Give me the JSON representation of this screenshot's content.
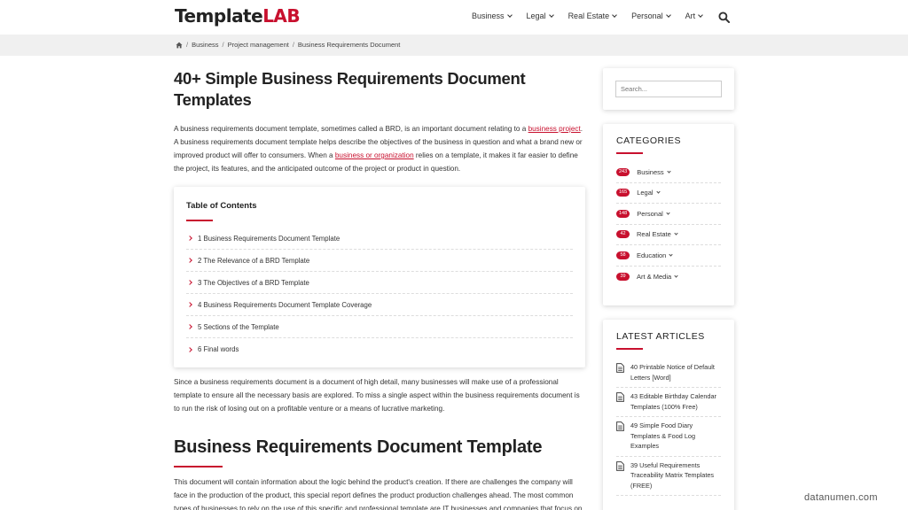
{
  "header": {
    "logo_main": "Template",
    "logo_accent": "LAB",
    "nav": [
      {
        "label": "Business"
      },
      {
        "label": "Legal"
      },
      {
        "label": "Real Estate"
      },
      {
        "label": "Personal"
      },
      {
        "label": "Art"
      }
    ]
  },
  "breadcrumb": [
    "Business",
    "Project management",
    "Business Requirements Document"
  ],
  "main": {
    "title": "40+ Simple Business Requirements Document Templates",
    "intro": {
      "t1": "A business requirements document template, sometimes called a BRD, is an important document relating to a ",
      "link1": "business project",
      "t2": ". A business requirements document template helps describe the objectives of the business in question and what a brand new or improved product will offer to consumers.  When a ",
      "link2": "business or organization",
      "t3": " relies on a template, it makes it far easier to define the project, its features, and the anticipated outcome of the project or product in question."
    },
    "toc": {
      "title": "Table of Contents",
      "items": [
        "1 Business Requirements Document Template",
        "2 The Relevance of a BRD Template",
        "3 The Objectives of a BRD Template",
        "4 Business Requirements Document Template Coverage",
        "5 Sections of the Template",
        "6 Final words"
      ]
    },
    "para2": "Since a business requirements document is a document of high detail, many businesses will make use of a professional template to ensure all the necessary basis are explored. To miss a single aspect within the business requirements document is to run the risk of losing out on a profitable venture or a means of lucrative marketing.",
    "h2": "Business Requirements Document Template",
    "para3": "This document will contain information about the logic behind the product's creation.  If there are challenges the company will face in the production of the product, this special report defines the product production challenges ahead.  The most common types of businesses to rely on the use of this specific and professional template are IT businesses and companies that focus on"
  },
  "sidebar": {
    "search_placeholder": "Search...",
    "categories_title": "CATEGORIES",
    "categories": [
      {
        "count": "243",
        "label": "Business"
      },
      {
        "count": "165",
        "label": "Legal"
      },
      {
        "count": "148",
        "label": "Personal"
      },
      {
        "count": "42",
        "label": "Real Estate"
      },
      {
        "count": "58",
        "label": "Education"
      },
      {
        "count": "39",
        "label": "Art & Media"
      }
    ],
    "latest_title": "LATEST ARTICLES",
    "latest": [
      "40 Printable Notice of Default Letters [Word]",
      "43 Editable Birthday Calendar Templates (100% Free)",
      "49 Simple Food Diary Templates & Food Log Examples",
      "39 Useful Requirements Traceability Matrix Templates (FREE)"
    ]
  },
  "watermark": "datanumen.com",
  "colors": {
    "accent": "#c8102e",
    "breadcrumb_bg": "#f0f0f0"
  },
  "icons": {
    "search": "search-icon",
    "home": "home-icon",
    "document": "document-icon"
  }
}
